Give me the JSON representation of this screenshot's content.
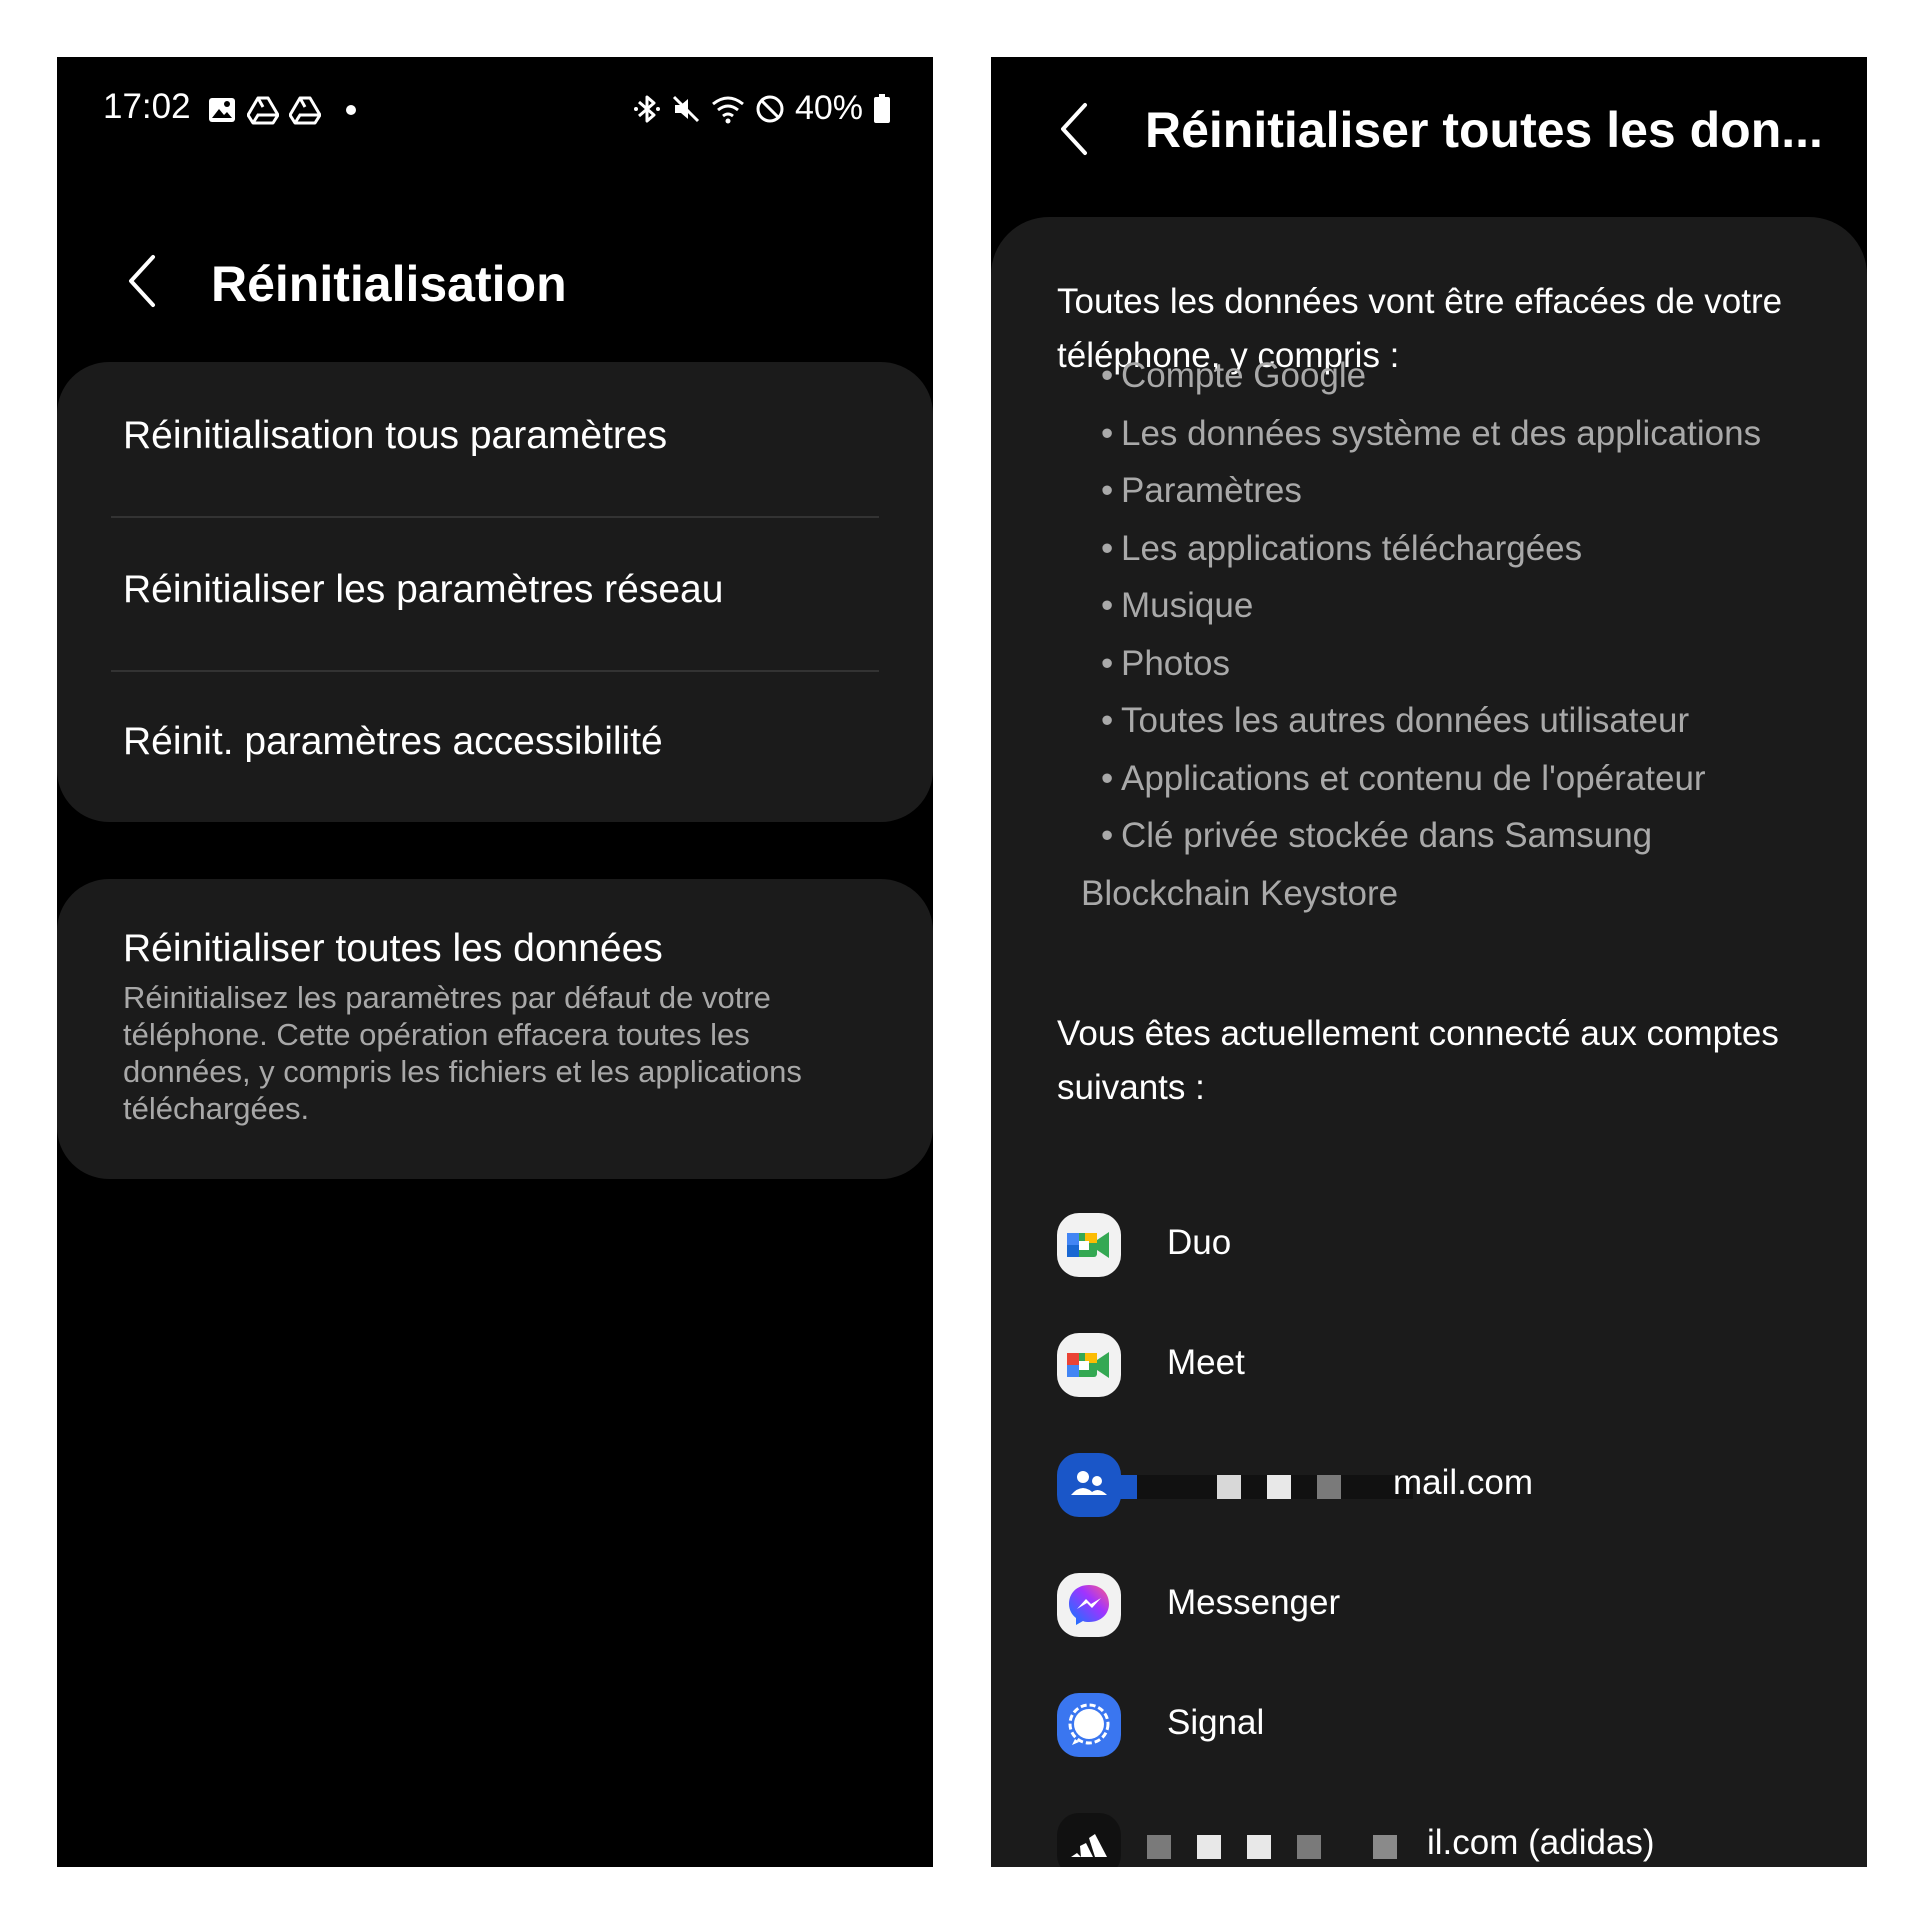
{
  "left": {
    "status_bar": {
      "time": "17:02",
      "battery": "40%",
      "icons_left": [
        "gallery-icon",
        "drive-icon",
        "drive-icon",
        "dot-icon"
      ],
      "icons_right": [
        "bluetooth-icon",
        "mute-icon",
        "wifi-icon",
        "do-not-disturb-icon",
        "battery-icon"
      ]
    },
    "header": {
      "title": "Réinitialisation"
    },
    "menu": [
      {
        "label": "Réinitialisation tous paramètres"
      },
      {
        "label": "Réinitialiser les paramètres réseau"
      },
      {
        "label": "Réinit. paramètres accessibilité"
      }
    ],
    "factory_reset": {
      "title": "Réinitialiser toutes les données",
      "description": "Réinitialisez les paramètres par défaut de votre téléphone. Cette opération effacera toutes les données, y compris les fichiers et les applications téléchargées."
    }
  },
  "right": {
    "header": {
      "title": "Réinitialiser toutes les don..."
    },
    "intro": "Toutes les données vont être effacées de votre téléphone, y compris :",
    "bullets": [
      "Compte Google",
      "Les données système et des applications",
      "Paramètres",
      "Les applications téléchargées",
      "Musique",
      "Photos",
      "Toutes les autres données utilisateur",
      "Applications et contenu de l'opérateur",
      "Clé privée stockée dans Samsung",
      "Blockchain Keystore"
    ],
    "accounts_intro": "Vous êtes actuellement connecté aux comptes suivants :",
    "accounts": [
      {
        "label": "Duo",
        "icon": "duo-icon"
      },
      {
        "label": "Meet",
        "icon": "meet-icon"
      },
      {
        "label": "mail.com",
        "icon": "family-link-icon"
      },
      {
        "label": "Messenger",
        "icon": "messenger-icon"
      },
      {
        "label": "Signal",
        "icon": "signal-icon"
      },
      {
        "label": "il.com (adidas)",
        "icon": "adidas-icon"
      }
    ]
  },
  "colors": {
    "background": "#000000",
    "card": "#1b1b1b",
    "text_primary": "#ffffff",
    "text_secondary": "#a8a8a8",
    "signal_blue": "#3a76f0",
    "family_blue": "#1a56c8"
  }
}
